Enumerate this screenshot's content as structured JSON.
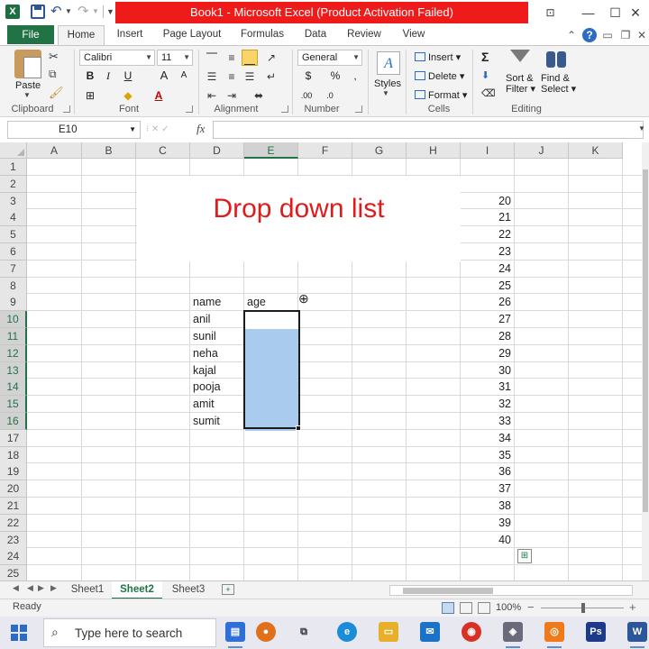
{
  "window": {
    "title": "Book1 - Microsoft Excel (Product Activation Failed)",
    "logo": "X"
  },
  "tabs": {
    "file": "File",
    "items": [
      "Home",
      "Insert",
      "Page Layout",
      "Formulas",
      "Data",
      "Review",
      "View"
    ]
  },
  "ribbon": {
    "clipboard": {
      "paste": "Paste",
      "label": "Clipboard"
    },
    "font": {
      "name": "Calibri",
      "size": "11",
      "bold": "B",
      "italic": "I",
      "underline": "U",
      "label": "Font"
    },
    "alignment": {
      "label": "Alignment"
    },
    "number": {
      "format": "General",
      "currency": "$",
      "percent": "%",
      "comma": ",",
      "label": "Number"
    },
    "styles": {
      "label": "Styles"
    },
    "cells": {
      "insert": "Insert",
      "delete": "Delete",
      "format": "Format",
      "label": "Cells"
    },
    "editing": {
      "autosum": "Σ",
      "sort": "Sort &",
      "sort2": "Filter",
      "find": "Find &",
      "find2": "Select",
      "label": "Editing"
    }
  },
  "formula_bar": {
    "name_box": "E10",
    "fx": "fx",
    "value": ""
  },
  "sheet": {
    "columns": [
      "A",
      "B",
      "C",
      "D",
      "E",
      "F",
      "G",
      "H",
      "I",
      "J",
      "K"
    ],
    "rows": [
      "1",
      "2",
      "3",
      "4",
      "5",
      "6",
      "7",
      "8",
      "9",
      "10",
      "11",
      "12",
      "13",
      "14",
      "15",
      "16",
      "17",
      "18",
      "19",
      "20",
      "21",
      "22",
      "23",
      "24",
      "25"
    ],
    "selected_column": "E",
    "selected_rows": [
      "10",
      "11",
      "12",
      "13",
      "14",
      "15",
      "16"
    ],
    "title": "Drop down list",
    "header_name": "name",
    "header_age": "age",
    "names": [
      "anil",
      "sunil",
      "neha",
      "kajal",
      "pooja",
      "amit",
      "sumit"
    ],
    "ages": [
      "20",
      "21",
      "22",
      "23",
      "24",
      "25",
      "26",
      "27",
      "28",
      "29",
      "30",
      "31",
      "32",
      "33",
      "34",
      "35",
      "36",
      "37",
      "38",
      "39",
      "40"
    ],
    "title_color": "#e01b1b",
    "selection_color": "#a9cbee"
  },
  "sheet_tabs": [
    "Sheet1",
    "Sheet2",
    "Sheet3"
  ],
  "active_sheet": "Sheet2",
  "status": {
    "text": "Ready",
    "zoom": "100%"
  },
  "taskbar": {
    "search_placeholder": "Type here to search"
  }
}
